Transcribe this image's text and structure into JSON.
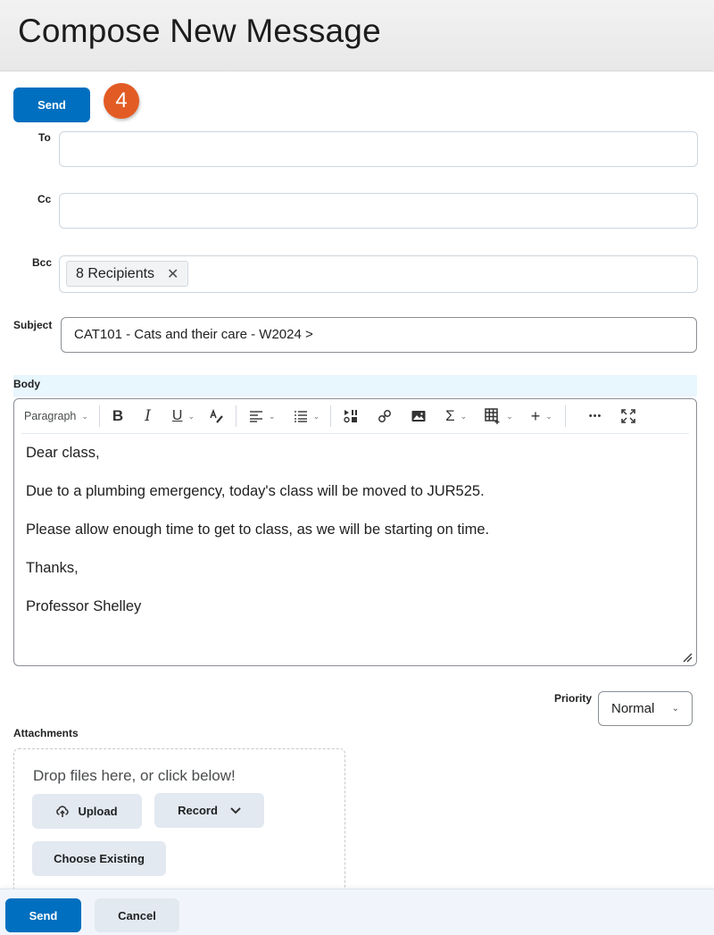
{
  "header": {
    "title": "Compose New Message"
  },
  "top_actions": {
    "send_label": "Send",
    "step_badge": "4"
  },
  "fields": {
    "to": {
      "label": "To",
      "value": ""
    },
    "cc": {
      "label": "Cc",
      "value": ""
    },
    "bcc": {
      "label": "Bcc",
      "chip_label": "8 Recipients",
      "chip_remove": "✕"
    },
    "subject": {
      "label": "Subject",
      "value": "CAT101 - Cats and their care - W2024 >"
    }
  },
  "body": {
    "label": "Body",
    "toolbar": {
      "format_select": "Paragraph",
      "bold": "B",
      "italic": "I",
      "underline": "U",
      "more": "•••"
    },
    "paragraphs": [
      "Dear class,",
      "Due to a plumbing emergency, today's class will be moved to JUR525.",
      "Please allow enough time to get to class, as we will be starting on time.",
      "Thanks,",
      "Professor Shelley"
    ]
  },
  "priority": {
    "label": "Priority",
    "selected": "Normal"
  },
  "attachments": {
    "label": "Attachments",
    "drop_text": "Drop files here, or click below!",
    "upload_label": "Upload",
    "record_label": "Record",
    "choose_existing_label": "Choose Existing"
  },
  "footer": {
    "send_label": "Send",
    "cancel_label": "Cancel"
  },
  "colors": {
    "primary": "#006fbf",
    "badge": "#e35b24",
    "secondary_button": "#e3e9f1",
    "body_highlight": "#e8f6fd"
  }
}
